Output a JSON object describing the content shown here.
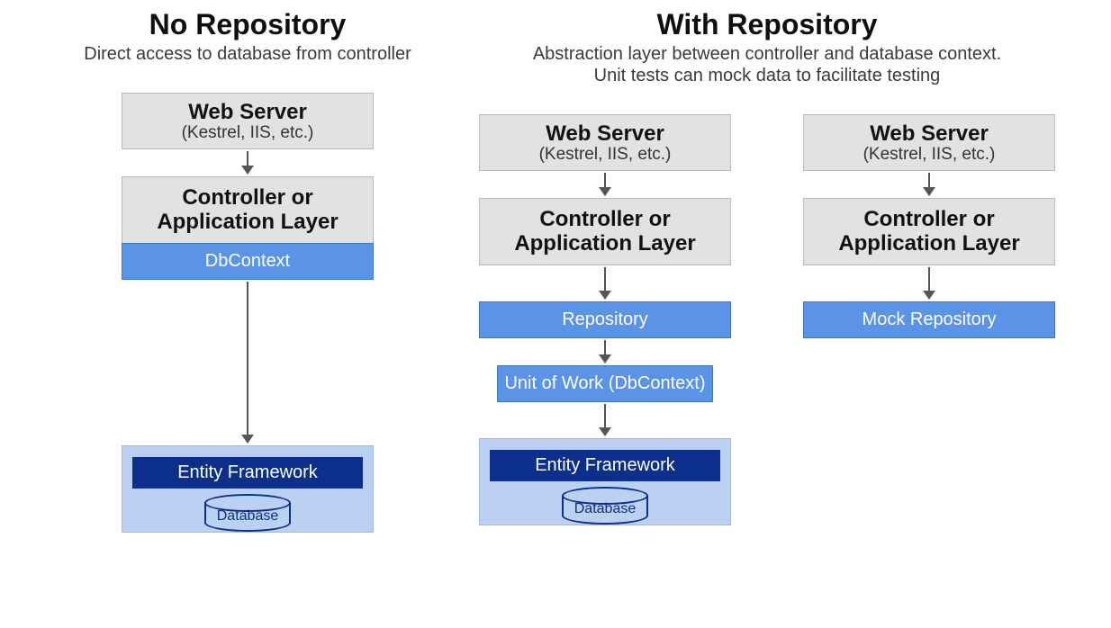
{
  "left": {
    "title": "No Repository",
    "subtitle": "Direct access to database from controller",
    "webserver_title": "Web Server",
    "webserver_sub": "(Kestrel, IIS, etc.)",
    "controller_line1": "Controller or",
    "controller_line2": "Application Layer",
    "dbcontext": "DbContext",
    "ef": "Entity Framework",
    "db": "Database"
  },
  "right": {
    "title": "With Repository",
    "subtitle_line1": "Abstraction layer between controller and database context.",
    "subtitle_line2": "Unit tests can mock data to facilitate testing",
    "colA": {
      "webserver_title": "Web Server",
      "webserver_sub": "(Kestrel, IIS, etc.)",
      "controller_line1": "Controller or",
      "controller_line2": "Application Layer",
      "repository": "Repository",
      "uow": "Unit of Work (DbContext)",
      "ef": "Entity Framework",
      "db": "Database"
    },
    "colB": {
      "webserver_title": "Web Server",
      "webserver_sub": "(Kestrel, IIS, etc.)",
      "controller_line1": "Controller or",
      "controller_line2": "Application Layer",
      "mock": "Mock Repository"
    }
  }
}
